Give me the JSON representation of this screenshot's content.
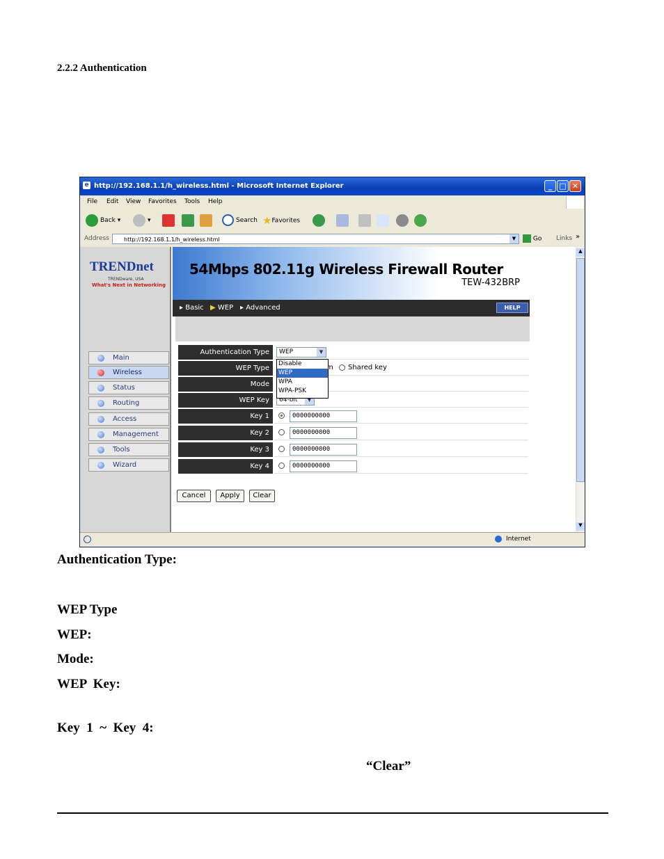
{
  "section": {
    "heading": "2.2.2  Authentication"
  },
  "browser": {
    "title": "http://192.168.1.1/h_wireless.html - Microsoft Internet Explorer",
    "menu": [
      "File",
      "Edit",
      "View",
      "Favorites",
      "Tools",
      "Help"
    ],
    "toolbar": {
      "back": "Back",
      "search": "Search",
      "favorites": "Favorites"
    },
    "address_label": "Address",
    "address_value": "http://192.168.1.1/h_wireless.html",
    "go": "Go",
    "links": "Links",
    "status_zone": "Internet"
  },
  "router": {
    "brand": "TRENDnet",
    "brand_sub": "TRENDware, USA",
    "tagline": "What's Next in Networking",
    "banner_title": "54Mbps 802.11g Wireless Firewall Router",
    "model": "TEW-432BRP",
    "breadcrumb": [
      "Basic",
      "WEP",
      "Advanced"
    ],
    "help": "HELP",
    "nav": [
      "Main",
      "Wireless",
      "Status",
      "Routing",
      "Access",
      "Management",
      "Tools",
      "Wizard"
    ],
    "active_nav": "Wireless",
    "form": {
      "auth_type_label": "Authentication Type",
      "auth_type_value": "WEP",
      "auth_options": [
        "Disable",
        "WEP",
        "WPA",
        "WPA-PSK"
      ],
      "wep_type_label": "WEP Type",
      "wep_type_partial": "m",
      "shared_key": "Shared key",
      "mode_label": "Mode",
      "wep_key_label": "WEP Key",
      "wep_key_value": "64-bit",
      "keys": [
        {
          "label": "Key 1",
          "value": "0000000000",
          "selected": true
        },
        {
          "label": "Key 2",
          "value": "0000000000",
          "selected": false
        },
        {
          "label": "Key 3",
          "value": "0000000000",
          "selected": false
        },
        {
          "label": "Key 4",
          "value": "0000000000",
          "selected": false
        }
      ],
      "buttons": {
        "cancel": "Cancel",
        "apply": "Apply",
        "clear": "Clear"
      }
    }
  },
  "descriptions": {
    "auth_type": "Authentication Type:",
    "wep_type": "WEP Type",
    "wep": "WEP:",
    "mode": "Mode:",
    "wep_key": "WEP  Key:",
    "keys": "Key  1  ~  Key  4:",
    "clear": "“Clear”"
  }
}
